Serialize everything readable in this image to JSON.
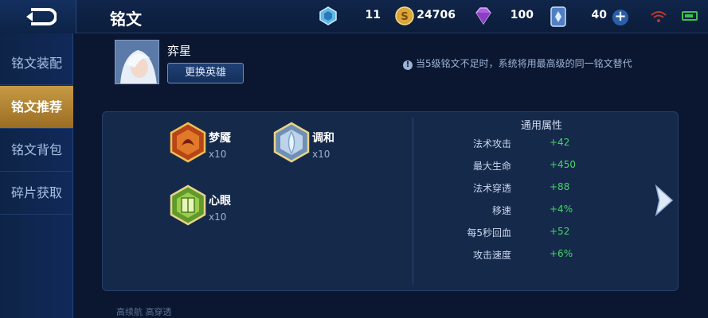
{
  "topbar": {
    "title": "铭文",
    "resources": [
      {
        "icon": "crystal-icon",
        "value": "11"
      },
      {
        "icon": "gold-coin-icon",
        "value": "24706"
      },
      {
        "icon": "diamond-icon",
        "value": "100"
      },
      {
        "icon": "voucher-icon",
        "value": "40"
      }
    ]
  },
  "sidebar": {
    "items": [
      {
        "label": "铭文装配",
        "active": false
      },
      {
        "label": "铭文推荐",
        "active": true
      },
      {
        "label": "铭文背包",
        "active": false
      },
      {
        "label": "碎片获取",
        "active": false
      }
    ]
  },
  "hero": {
    "name": "弈星",
    "change_label": "更换英雄"
  },
  "notice": "当5级铭文不足时，系统将用最高级的同一铭文替代",
  "runes": [
    {
      "name": "梦魇",
      "count": "x10",
      "color": "#d0501f"
    },
    {
      "name": "调和",
      "count": "x10",
      "color": "#8fb0cf"
    },
    {
      "name": "心眼",
      "count": "x10",
      "color": "#7fb33a"
    }
  ],
  "attributes": {
    "title": "通用属性",
    "rows": [
      {
        "name": "法术攻击",
        "value": "+42"
      },
      {
        "name": "最大生命",
        "value": "+450"
      },
      {
        "name": "法术穿透",
        "value": "+88"
      },
      {
        "name": "移速",
        "value": "+4%"
      },
      {
        "name": "每5秒回血",
        "value": "+52"
      },
      {
        "name": "攻击速度",
        "value": "+6%"
      }
    ]
  },
  "footer": "高续航 高穿透"
}
